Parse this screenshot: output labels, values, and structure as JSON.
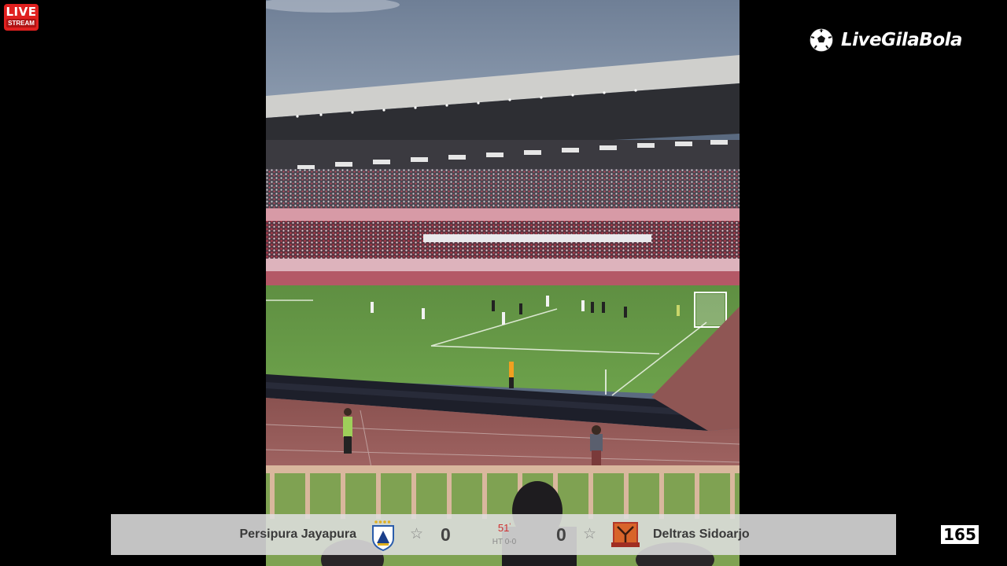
{
  "overlay": {
    "live_label": "LIVE",
    "stream_label": "STREAM",
    "brand_name": "LiveGilaBola",
    "viewer_count": "165"
  },
  "video": {
    "description_icon": "stadium-video-feed"
  },
  "match": {
    "home_team": "Persipura Jayapura",
    "away_team": "Deltras Sidoarjo",
    "home_score": "0",
    "away_score": "0",
    "minute": "51",
    "minute_mark": "'",
    "halftime": "HT 0-0",
    "favorite_icon": "star-outline-icon"
  },
  "colors": {
    "live_red": "#e0201f",
    "minute_red": "#d03030",
    "scorebar_bg": "#dedede"
  }
}
